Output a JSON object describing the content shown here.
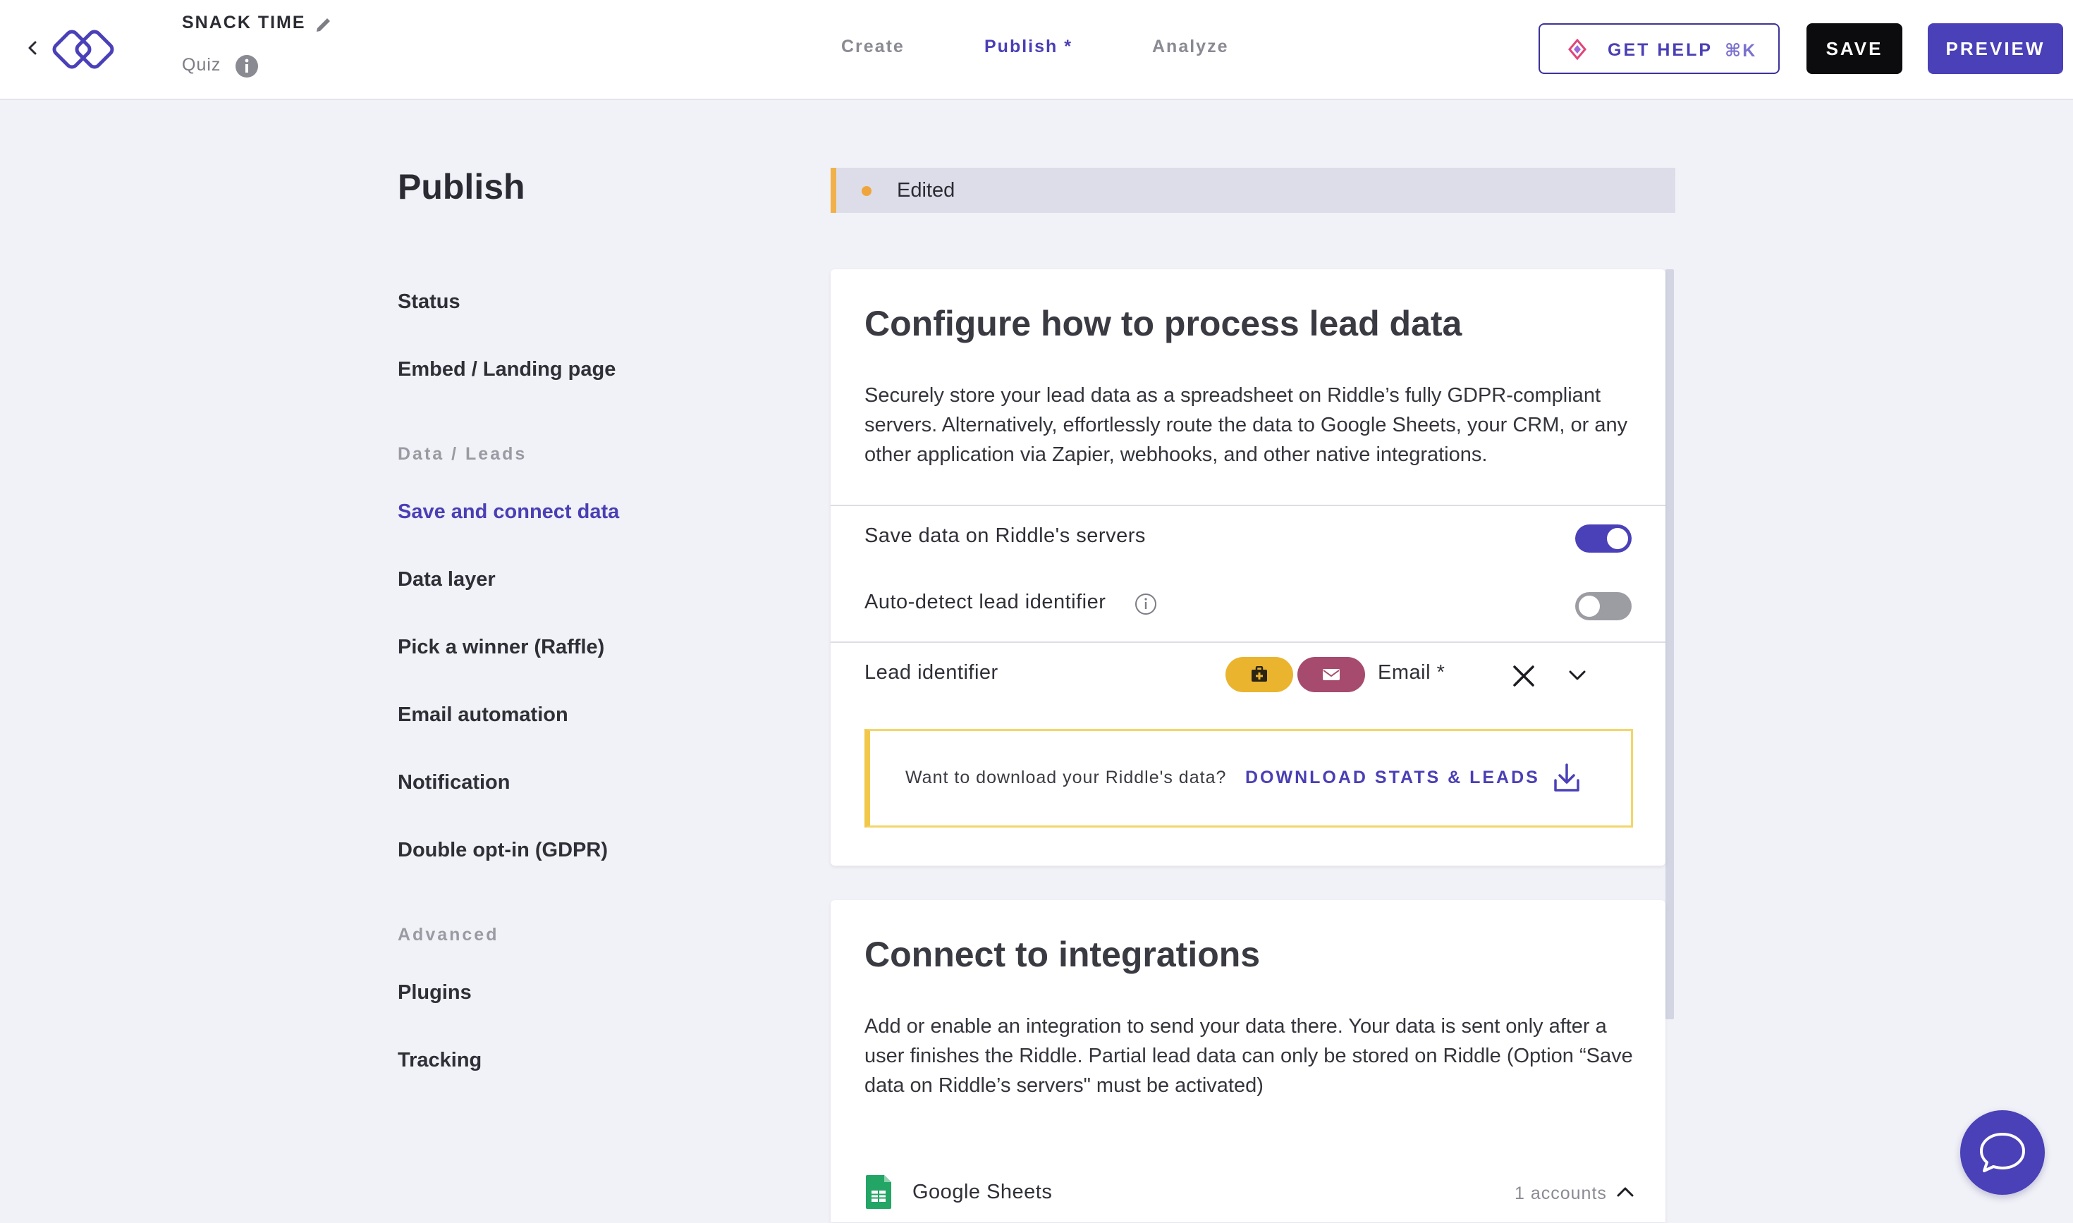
{
  "header": {
    "title": "SNACK TIME",
    "type": "Quiz",
    "tabs": [
      {
        "label": "Create"
      },
      {
        "label": "Publish *"
      },
      {
        "label": "Analyze"
      }
    ],
    "help": {
      "label": "GET HELP",
      "shortcut": "⌘K"
    },
    "save_label": "SAVE",
    "preview_label": "PREVIEW"
  },
  "sidebar": {
    "page_title": "Publish",
    "items_top": [
      {
        "label": "Status"
      },
      {
        "label": "Embed / Landing page"
      }
    ],
    "group_data": "Data / Leads",
    "items_data": [
      {
        "label": "Save and connect data"
      },
      {
        "label": "Data layer"
      },
      {
        "label": "Pick a winner (Raffle)"
      },
      {
        "label": "Email automation"
      },
      {
        "label": "Notification"
      },
      {
        "label": "Double opt-in (GDPR)"
      }
    ],
    "group_advanced": "Advanced",
    "items_advanced": [
      {
        "label": "Plugins"
      },
      {
        "label": "Tracking"
      }
    ]
  },
  "status_bar": {
    "label": "Edited"
  },
  "lead_card": {
    "title": "Configure how to process lead data",
    "description": "Securely store your lead data as a spreadsheet on Riddle’s fully GDPR-compliant servers. Alternatively, effortlessly route the data to Google Sheets, your CRM, or any other application via Zapier, webhooks, and other native integrations.",
    "save_on_servers": {
      "label": "Save data on Riddle's servers",
      "enabled": true
    },
    "auto_detect": {
      "label": "Auto-detect lead identifier",
      "enabled": false
    },
    "lead_identifier": {
      "label": "Lead identifier",
      "value": "Email *"
    },
    "download": {
      "question": "Want to download your Riddle's data?",
      "link": "DOWNLOAD STATS & LEADS"
    }
  },
  "integrations_card": {
    "title": "Connect to integrations",
    "description": "Add or enable an integration to send your data there. Your data is sent only after a user finishes the Riddle. Partial lead data can only be stored on Riddle (Option “Save data on Riddle’s servers\" must be activated)",
    "items": [
      {
        "name": "Google Sheets",
        "accounts": "1 accounts"
      }
    ]
  },
  "colors": {
    "brand": "#4a40b8",
    "edited_accent": "#f0b14a",
    "toggle_off": "#9c9ca3"
  },
  "icons": [
    "chevron-left-icon",
    "riddle-logo",
    "pencil-icon",
    "info-icon",
    "diamond-icon",
    "checkbox-plus-icon",
    "envelope-icon",
    "close-icon",
    "chevron-down-icon",
    "download-icon",
    "google-sheets-icon",
    "chevron-up-icon",
    "chat-bubble-icon"
  ]
}
